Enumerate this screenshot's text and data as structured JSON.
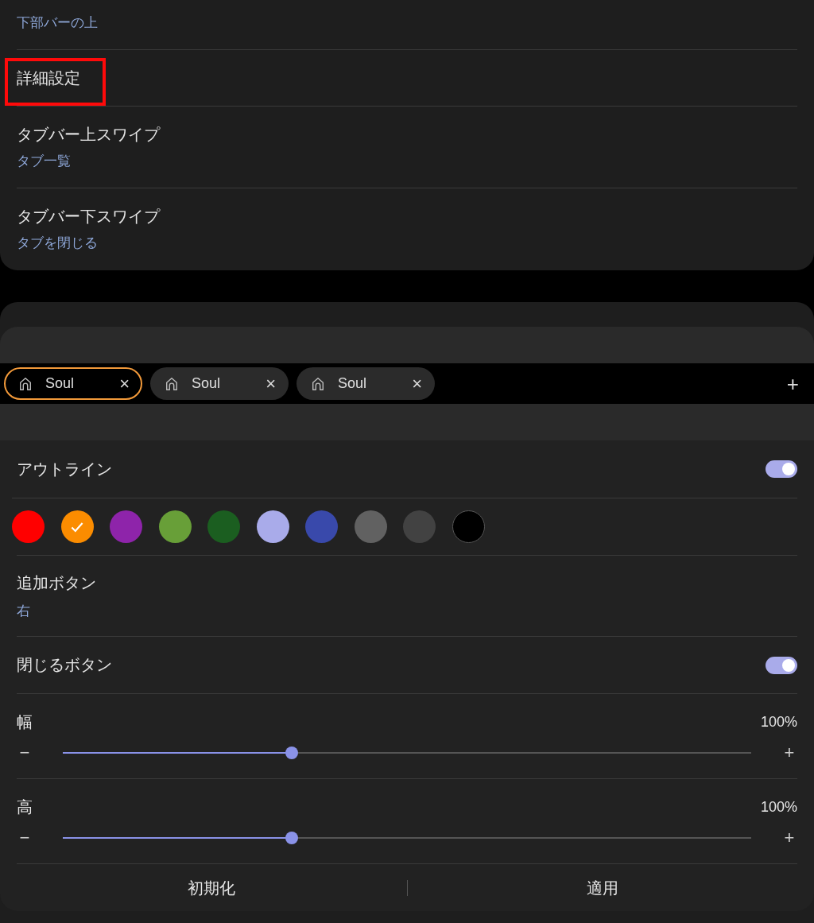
{
  "top_card": {
    "items": [
      {
        "subtitle": "下部バーの上",
        "highlighted": false
      },
      {
        "title": "詳細設定",
        "highlighted": true
      },
      {
        "title": "タブバー上スワイプ",
        "subtitle": "タブ一覧",
        "highlighted": false
      },
      {
        "title": "タブバー下スワイプ",
        "subtitle": "タブを閉じる",
        "highlighted": false
      }
    ]
  },
  "tab_preview": {
    "tabs": [
      {
        "label": "Soul",
        "close": "×",
        "selected": true
      },
      {
        "label": "Soul",
        "close": "×",
        "selected": false
      },
      {
        "label": "Soul",
        "close": "×",
        "selected": false
      }
    ],
    "add": "+"
  },
  "settings": [
    {
      "kind": "toggle",
      "title": "アウトライン",
      "on": true
    },
    {
      "kind": "colors",
      "colors": [
        {
          "color": "#ff0000",
          "selected": false
        },
        {
          "color": "#fb8c00",
          "selected": true
        },
        {
          "color": "#8e24aa",
          "selected": false
        },
        {
          "color": "#689f38",
          "selected": false
        },
        {
          "color": "#1b5e20",
          "selected": false
        },
        {
          "color": "#a9abea",
          "selected": false
        },
        {
          "color": "#3949ab",
          "selected": false
        },
        {
          "color": "#616161",
          "selected": false
        },
        {
          "color": "#424242",
          "selected": false
        },
        {
          "color": "#000000",
          "selected": false
        }
      ]
    },
    {
      "kind": "value",
      "title": "追加ボタン",
      "subtitle": "右"
    },
    {
      "kind": "toggle",
      "title": "閉じるボタン",
      "on": true
    },
    {
      "kind": "slider",
      "title": "幅",
      "reading": "100%",
      "minus": "−",
      "plus": "+",
      "level": 0.333
    },
    {
      "kind": "slider",
      "title": "高",
      "reading": "100%",
      "minus": "−",
      "plus": "+",
      "level": 0.333
    }
  ],
  "buttons": [
    "初期化",
    "適用"
  ]
}
